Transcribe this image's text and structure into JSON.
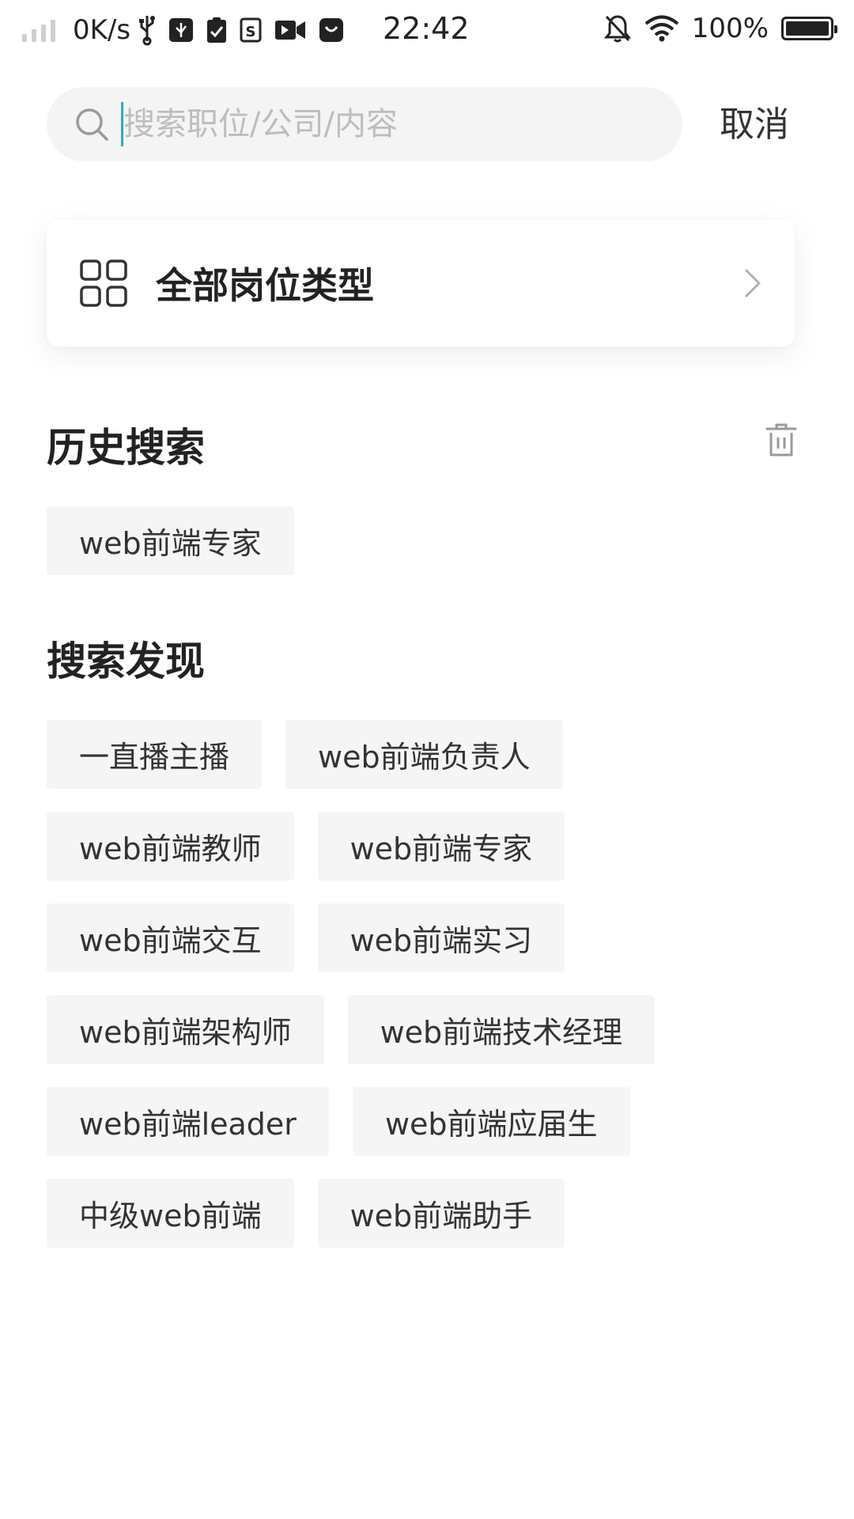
{
  "status_bar": {
    "speed": "0K/s",
    "time": "22:42",
    "battery": "100%"
  },
  "search": {
    "placeholder": "搜索职位/公司/内容",
    "value": "",
    "cancel_label": "取消"
  },
  "category": {
    "label": "全部岗位类型"
  },
  "history": {
    "title": "历史搜索",
    "items": [
      "web前端专家"
    ]
  },
  "discover": {
    "title": "搜索发现",
    "items": [
      "一直播主播",
      "web前端负责人",
      "web前端教师",
      "web前端专家",
      "web前端交互",
      "web前端实习",
      "web前端架构师",
      "web前端技术经理",
      "web前端leader",
      "web前端应届生",
      "中级web前端",
      "web前端助手"
    ]
  },
  "colors": {
    "accent_caret": "#25b0b5",
    "tag_background": "#f5f5f5",
    "search_background": "#f4f4f4"
  },
  "icons": [
    "signal-icon",
    "usb-icon",
    "notification-icons",
    "silent-bell-icon",
    "wifi-icon",
    "battery-icon",
    "search-icon",
    "grid-icon",
    "chevron-right-icon",
    "trash-icon"
  ]
}
